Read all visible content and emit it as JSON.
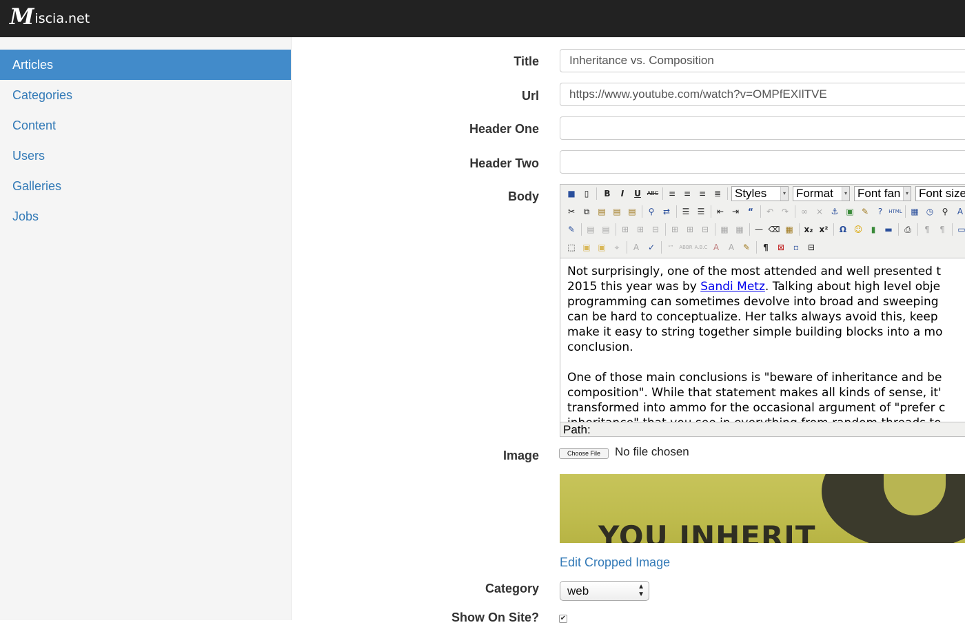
{
  "brand": {
    "logo_letter": "M",
    "text": "iscia.net"
  },
  "sidebar": {
    "items": [
      {
        "label": "Articles",
        "active": true
      },
      {
        "label": "Categories"
      },
      {
        "label": "Content"
      },
      {
        "label": "Users"
      },
      {
        "label": "Galleries"
      },
      {
        "label": "Jobs"
      }
    ]
  },
  "form": {
    "title": {
      "label": "Title",
      "value": "Inheritance vs. Composition"
    },
    "url": {
      "label": "Url",
      "value": "https://www.youtube.com/watch?v=OMPfEXIlTVE"
    },
    "header_one": {
      "label": "Header One",
      "value": ""
    },
    "header_two": {
      "label": "Header Two",
      "value": ""
    },
    "body": {
      "label": "Body",
      "toolbar": {
        "styles": "Styles",
        "format": "Format",
        "font_family": "Font fan",
        "font_size": "Font size"
      },
      "paragraph1_before_link": "Not surprisingly, one of the most attended and well presented t",
      "paragraph1_line2_pre": "2015 this year was by ",
      "link_text": "Sandi Metz",
      "paragraph1_line2_post": ". Talking about high level obje",
      "paragraph1_lines": [
        "programming can sometimes devolve into broad and sweeping",
        "can be hard to conceptualize. Her talks always avoid this, keep",
        "make it easy to string together simple building blocks into a mo",
        "conclusion."
      ],
      "paragraph2_lines": [
        "One of those main conclusions is \"beware of inheritance and be",
        "composition\". While that statement makes all kinds of sense, it'",
        "transformed into ammo for the occasional argument of \"prefer c",
        "inheritance\" that you see in everything from random threads to"
      ],
      "path_label": "Path:"
    },
    "image": {
      "label": "Image",
      "choose_button": "Choose File",
      "status": "No file chosen",
      "preview_caption": "YOU INHERIT",
      "edit_link": "Edit Cropped Image"
    },
    "category": {
      "label": "Category",
      "value": "web"
    },
    "show_on_site": {
      "label": "Show On Site?",
      "checked": true
    }
  }
}
